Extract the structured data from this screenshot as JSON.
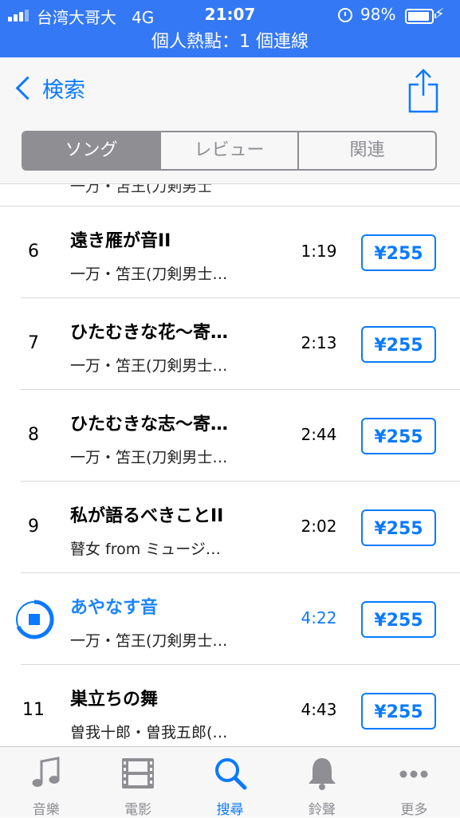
{
  "status": {
    "carrier": "台湾大哥大",
    "network": "4G",
    "time": "21:07",
    "battery": "98%",
    "hotspot": "個人熱點：1 個連線"
  },
  "nav": {
    "back_label": "検索"
  },
  "segments": [
    "ソング",
    "レビュー",
    "関連"
  ],
  "songs": [
    {
      "num": "6",
      "title": "遠き雁が音II",
      "artist": "一万・笘王(刀剣男士…",
      "duration": "1:19",
      "price": "¥255"
    },
    {
      "num": "7",
      "title": "ひたむきな花～寄…",
      "artist": "一万・笘王(刀剣男士…",
      "duration": "2:13",
      "price": "¥255"
    },
    {
      "num": "8",
      "title": "ひたむきな志～寄…",
      "artist": "一万・笘王(刀剣男士…",
      "duration": "2:44",
      "price": "¥255"
    },
    {
      "num": "9",
      "title": "私が語るべきことII",
      "artist": "瞽女 from ミュージ…",
      "duration": "2:02",
      "price": "¥255"
    },
    {
      "num": "",
      "title": "あやなす音",
      "artist": "一万・笘王(刀剣男士…",
      "duration": "4:22",
      "price": "¥255"
    },
    {
      "num": "11",
      "title": "巣立ちの舞",
      "artist": "曽我十郎・曽我五郎(…",
      "duration": "4:43",
      "price": "¥255"
    }
  ],
  "tabs": [
    {
      "label": "音樂",
      "icon": "music-note-icon"
    },
    {
      "label": "電影",
      "icon": "film-icon"
    },
    {
      "label": "搜尋",
      "icon": "search-icon"
    },
    {
      "label": "鈴聲",
      "icon": "bell-icon"
    },
    {
      "label": "更多",
      "icon": "more-icon"
    }
  ],
  "colors": {
    "accent": "#0a7aff",
    "status_bar": "#3478f6",
    "inactive": "#8e8e93"
  }
}
